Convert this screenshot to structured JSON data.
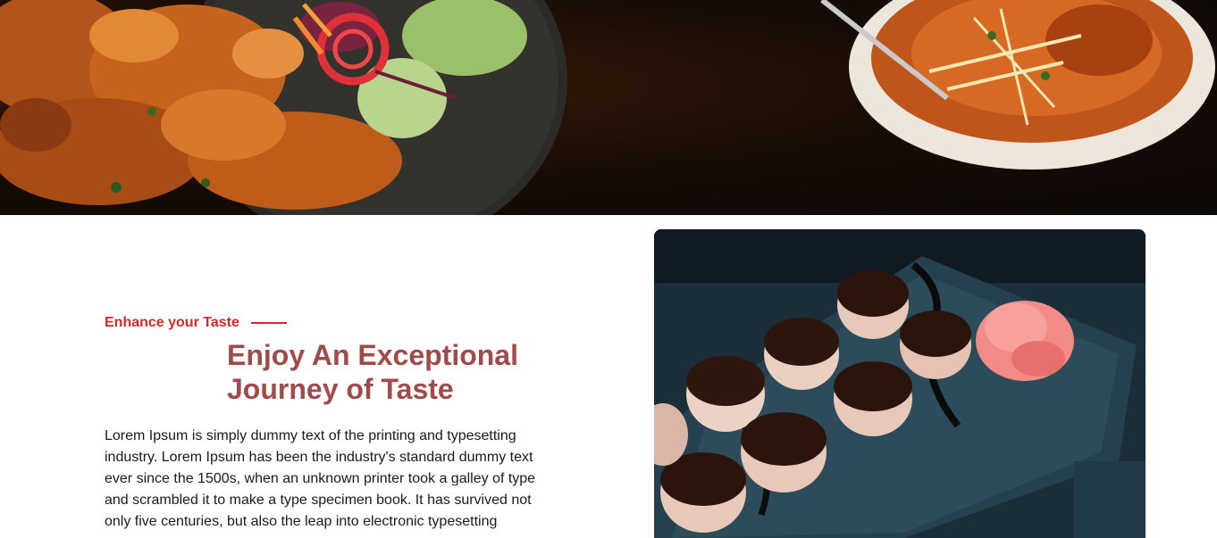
{
  "hero": {
    "image": "food-platter-and-curry-bowl-photo"
  },
  "intro": {
    "eyebrow": "Enhance your Taste",
    "heading_line1": "Enjoy An Exceptional",
    "heading_line2": "Journey of Taste",
    "body": "Lorem Ipsum is simply dummy text of the printing and typesetting industry. Lorem Ipsum has been the industry's standard dummy text ever since the 1500s, when an unknown printer took a galley of type and scrambled it to make a type specimen book. It has survived not only five centuries, but also the leap into electronic typesetting"
  },
  "feature": {
    "image": "glazed-scallops-on-slate-photo"
  },
  "colors": {
    "accent": "#d12a2a",
    "heading": "#a04a4a",
    "text": "#1a1a1a"
  }
}
